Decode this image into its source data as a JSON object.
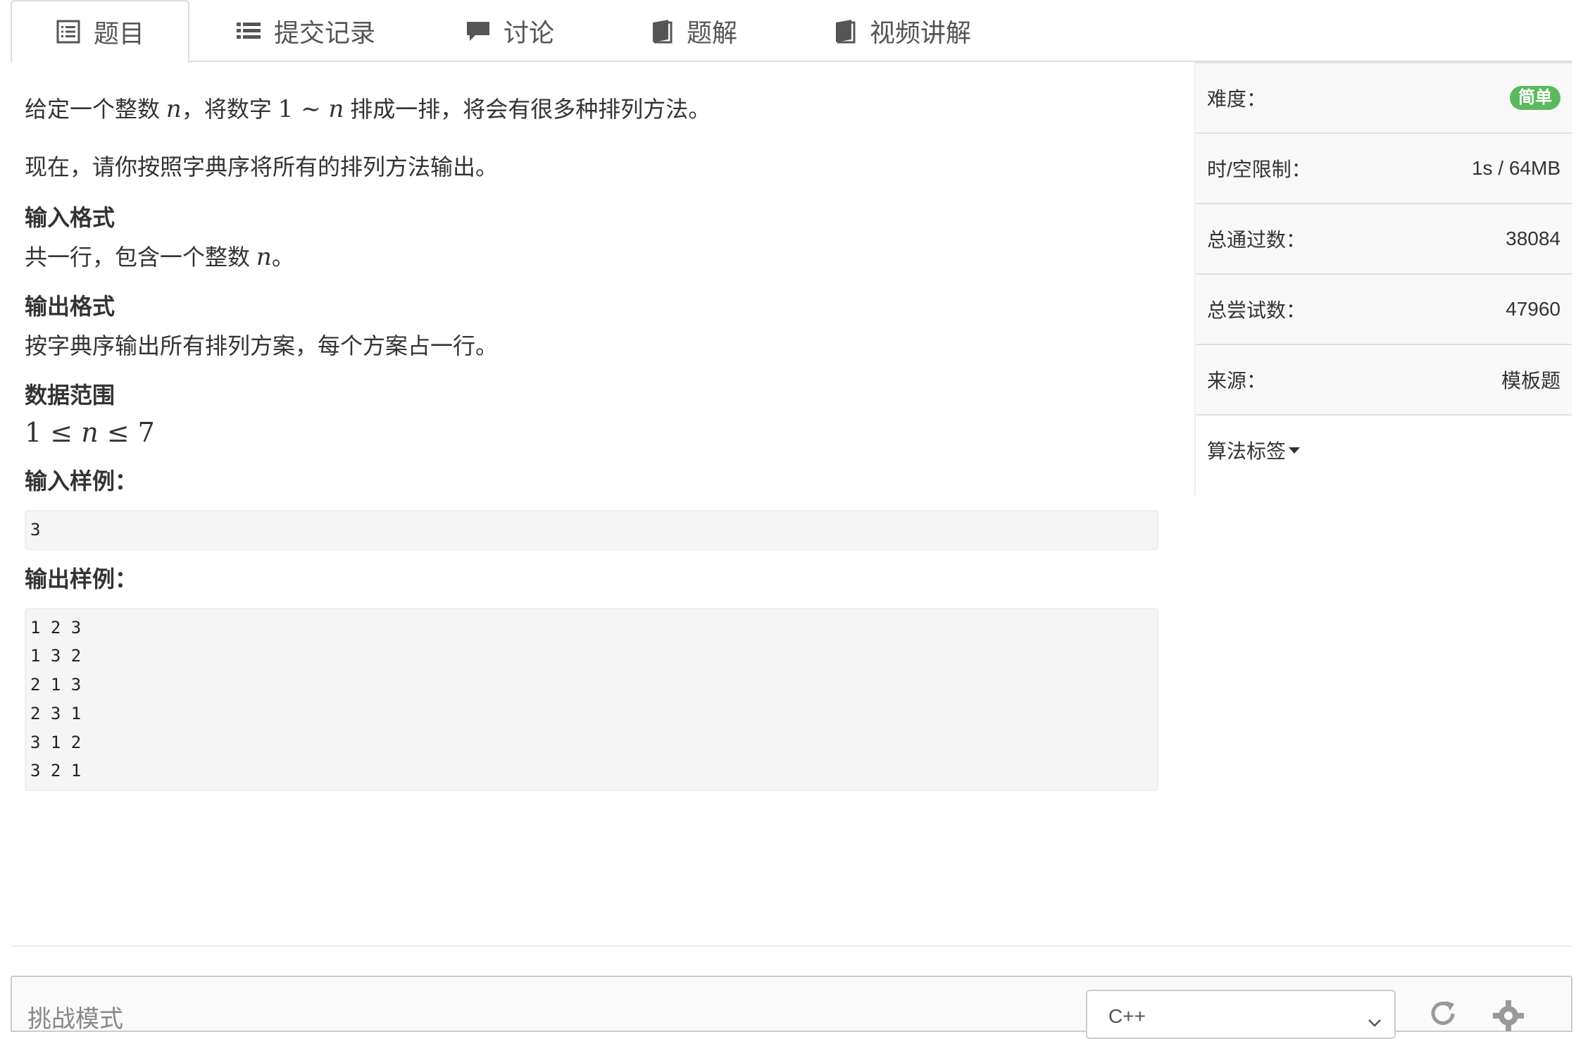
{
  "tabs": [
    {
      "label": "题目",
      "icon": "list-alt-icon",
      "active": true
    },
    {
      "label": "提交记录",
      "icon": "list-icon",
      "active": false
    },
    {
      "label": "讨论",
      "icon": "comment-icon",
      "active": false
    },
    {
      "label": "题解",
      "icon": "book-icon",
      "active": false
    },
    {
      "label": "视频讲解",
      "icon": "book-icon",
      "active": false
    }
  ],
  "problem": {
    "p1_a": "给定一个整数 ",
    "p1_n1": "n",
    "p1_b": "，将数字 ",
    "p1_one": "1",
    "p1_tilde": " ∼ ",
    "p1_n2": "n",
    "p1_c": " 排成一排，将会有很多种排列方法。",
    "p2": "现在，请你按照字典序将所有的排列方法输出。",
    "input_heading": "输入格式",
    "input_a": "共一行，包含一个整数 ",
    "input_n": "n",
    "input_b": "。",
    "output_heading": "输出格式",
    "output_desc": "按字典序输出所有排列方案，每个方案占一行。",
    "range_heading": "数据范围",
    "range_one": "1",
    "range_le1": " ≤ ",
    "range_n": "n",
    "range_le2": " ≤ ",
    "range_seven": "7",
    "sample_in_heading": "输入样例：",
    "sample_in": "3",
    "sample_out_heading": "输出样例：",
    "sample_out": "1 2 3\n1 3 2\n2 1 3\n2 3 1\n3 1 2\n3 2 1"
  },
  "sidebar": {
    "difficulty_label": "难度：",
    "difficulty_value": "简单",
    "limit_label": "时/空限制：",
    "limit_value": "1s / 64MB",
    "passed_label": "总通过数：",
    "passed_value": "38084",
    "attempts_label": "总尝试数：",
    "attempts_value": "47960",
    "source_label": "来源：",
    "source_value": "模板题",
    "tags_label": "算法标签"
  },
  "editor": {
    "mode_label": "挑战模式",
    "language": "C++",
    "reset_icon": "refresh-icon",
    "settings_icon": "gear-icon"
  },
  "colors": {
    "badge_green": "#5cb85c",
    "tab_border": "#dddddd",
    "sample_bg": "#f5f5f5",
    "sidebar_row_bg": "#f8f8f8"
  }
}
